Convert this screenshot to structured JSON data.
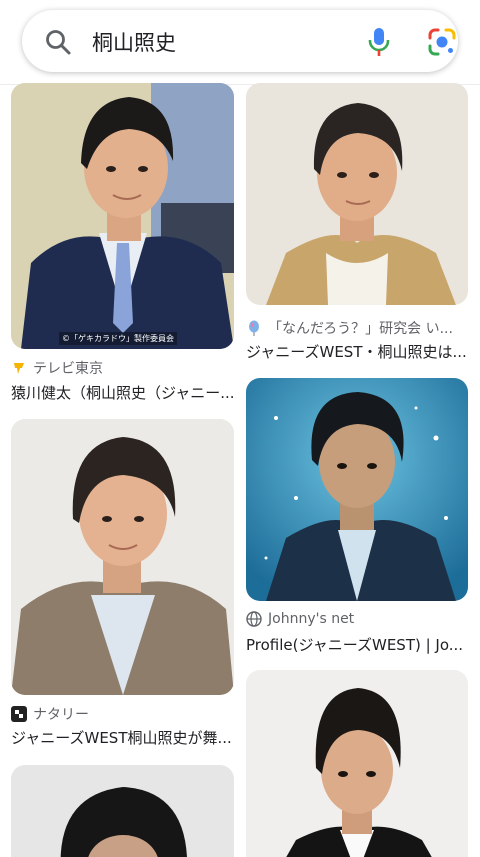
{
  "search": {
    "query": "桐山照史"
  },
  "results": [
    {
      "source": "テレビ東京",
      "title": "猿川健太（桐山照史（ジャニー...",
      "caption": "©「ゲキカラドウ」製作委員会",
      "source_icon": "tv-tokyo-icon"
    },
    {
      "source": "「なんだろう？」研究会 い...",
      "title": "ジャニーズWEST・桐山照史は...",
      "source_icon": "balloon-icon"
    },
    {
      "source": "ナタリー",
      "title": "ジャニーズWEST桐山照史が舞...",
      "source_icon": "natalie-icon"
    },
    {
      "source": "Johnny's net",
      "title": "Profile(ジャニーズWEST) | Jo...",
      "source_icon": "globe-icon"
    }
  ],
  "colors": {
    "mic_blue": "#4285F4",
    "mic_red": "#EA4335",
    "lens_yellow": "#FBBC04",
    "lens_green": "#34A853"
  }
}
